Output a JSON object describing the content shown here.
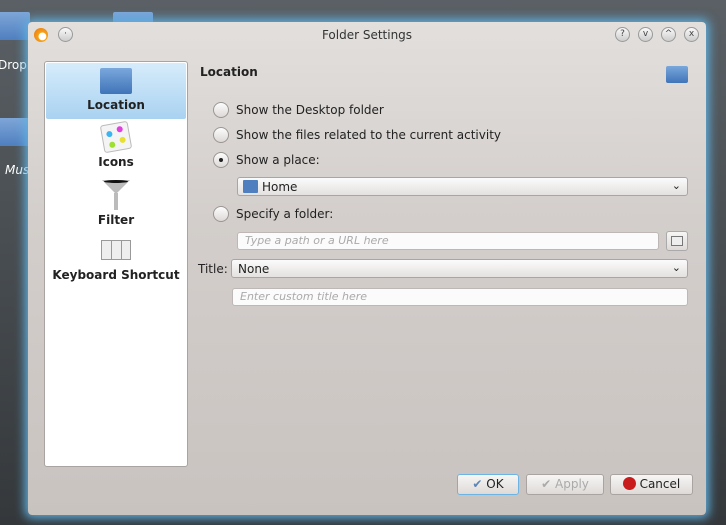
{
  "desktop": {
    "labels": [
      "Dropb",
      "Mus"
    ]
  },
  "window": {
    "title": "Folder Settings",
    "buttons": [
      "?",
      "v",
      "^",
      "x"
    ]
  },
  "sidebar": {
    "items": [
      {
        "label": "Location",
        "icon": "folder-icon",
        "selected": true
      },
      {
        "label": "Icons",
        "icon": "icons-icon"
      },
      {
        "label": "Filter",
        "icon": "funnel-icon"
      },
      {
        "label": "Keyboard Shortcut",
        "icon": "keyboard-icon"
      }
    ]
  },
  "main": {
    "heading": "Location",
    "options": [
      {
        "label": "Show the Desktop folder",
        "checked": false
      },
      {
        "label": "Show the files related to the current activity",
        "checked": false
      },
      {
        "label": "Show a place:",
        "checked": true
      },
      {
        "label": "Specify a folder:",
        "checked": false
      }
    ],
    "place_value": "Home",
    "path_placeholder": "Type a path or a URL here",
    "title_label": "Title:",
    "title_value": "None",
    "custom_title_placeholder": "Enter custom title here"
  },
  "footer": {
    "ok": "OK",
    "apply": "Apply",
    "cancel": "Cancel"
  }
}
